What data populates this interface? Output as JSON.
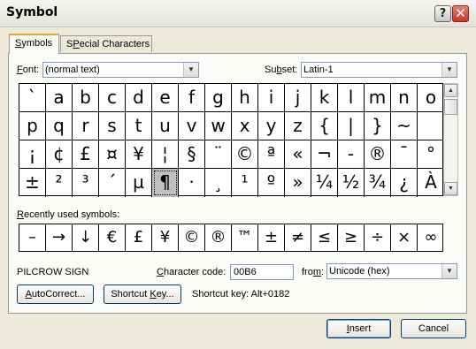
{
  "window": {
    "title": "Symbol"
  },
  "tabs": [
    {
      "label": "Symbols",
      "accel": "S",
      "rest": "ymbols"
    },
    {
      "label": "Special Characters",
      "accel": "P",
      "pre": "S",
      "rest": "ecial Characters"
    }
  ],
  "font": {
    "accel": "F",
    "rest": "ont:",
    "value": "(normal text)"
  },
  "subset": {
    "pre": "Su",
    "accel": "b",
    "rest": "set:",
    "value": "Latin-1"
  },
  "symbols": [
    [
      "`",
      "a",
      "b",
      "c",
      "d",
      "e",
      "f",
      "g",
      "h",
      "i",
      "j",
      "k",
      "l",
      "m",
      "n",
      "o"
    ],
    [
      "p",
      "q",
      "r",
      "s",
      "t",
      "u",
      "v",
      "w",
      "x",
      "y",
      "z",
      "{",
      "|",
      "}",
      "~",
      ""
    ],
    [
      "¡",
      "¢",
      "£",
      "¤",
      "¥",
      "¦",
      "§",
      "¨",
      "©",
      "ª",
      "«",
      "¬",
      "-",
      "®",
      "¯",
      "°"
    ],
    [
      "±",
      "²",
      "³",
      "´",
      "µ",
      "¶",
      "·",
      "¸",
      "¹",
      "º",
      "»",
      "¼",
      "½",
      "¾",
      "¿",
      "À"
    ]
  ],
  "selected_symbol": "¶",
  "recent": {
    "label_pre": "",
    "accel": "R",
    "label_rest": "ecently used symbols:",
    "items": [
      "–",
      "→",
      "↓",
      "€",
      "£",
      "¥",
      "©",
      "®",
      "™",
      "±",
      "≠",
      "≤",
      "≥",
      "÷",
      "×",
      "∞"
    ]
  },
  "char_name": "PILCROW SIGN",
  "char_code": {
    "accel": "C",
    "rest": "haracter code:",
    "value": "00B6"
  },
  "from": {
    "pre": "fro",
    "accel": "m",
    "rest": ":",
    "value": "Unicode (hex)"
  },
  "buttons": {
    "autocorrect": {
      "accel": "A",
      "rest": "utoCorrect..."
    },
    "shortcut_key": {
      "pre": "Shortcut ",
      "accel": "K",
      "rest": "ey..."
    },
    "insert": {
      "accel": "I",
      "rest": "nsert"
    },
    "cancel": "Cancel"
  },
  "shortcut_text": "Shortcut key: Alt+0182",
  "icons": {
    "help": "question-mark",
    "close": "x-mark",
    "dropdown": "chevron-down",
    "scroll_up": "arrow-up",
    "scroll_down": "arrow-down"
  }
}
